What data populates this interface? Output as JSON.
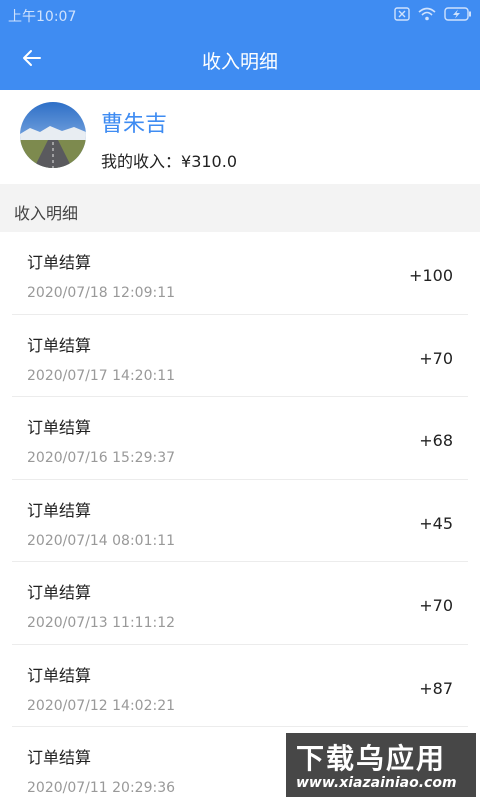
{
  "status_bar": {
    "time": "上午10:07"
  },
  "header": {
    "title": "收入明细"
  },
  "profile": {
    "name": "曹朱吉",
    "income_label": "我的收入：",
    "income_value": "¥310.0"
  },
  "section": {
    "title": "收入明细"
  },
  "records": [
    {
      "title": "订单结算",
      "time": "2020/07/18 12:09:11",
      "amount": "+100"
    },
    {
      "title": "订单结算",
      "time": "2020/07/17 14:20:11",
      "amount": "+70"
    },
    {
      "title": "订单结算",
      "time": "2020/07/16 15:29:37",
      "amount": "+68"
    },
    {
      "title": "订单结算",
      "time": "2020/07/14 08:01:11",
      "amount": "+45"
    },
    {
      "title": "订单结算",
      "time": "2020/07/13 11:11:12",
      "amount": "+70"
    },
    {
      "title": "订单结算",
      "time": "2020/07/12 14:02:21",
      "amount": "+87"
    },
    {
      "title": "订单结算",
      "time": "2020/07/11 20:29:36",
      "amount": ""
    }
  ],
  "watermark": {
    "line1": "下载乌应用",
    "line2": "www.xiazainiao.com"
  },
  "colors": {
    "primary": "#3f8cf2",
    "section_bg": "#f3f3f3",
    "secondary_text": "#999999"
  }
}
